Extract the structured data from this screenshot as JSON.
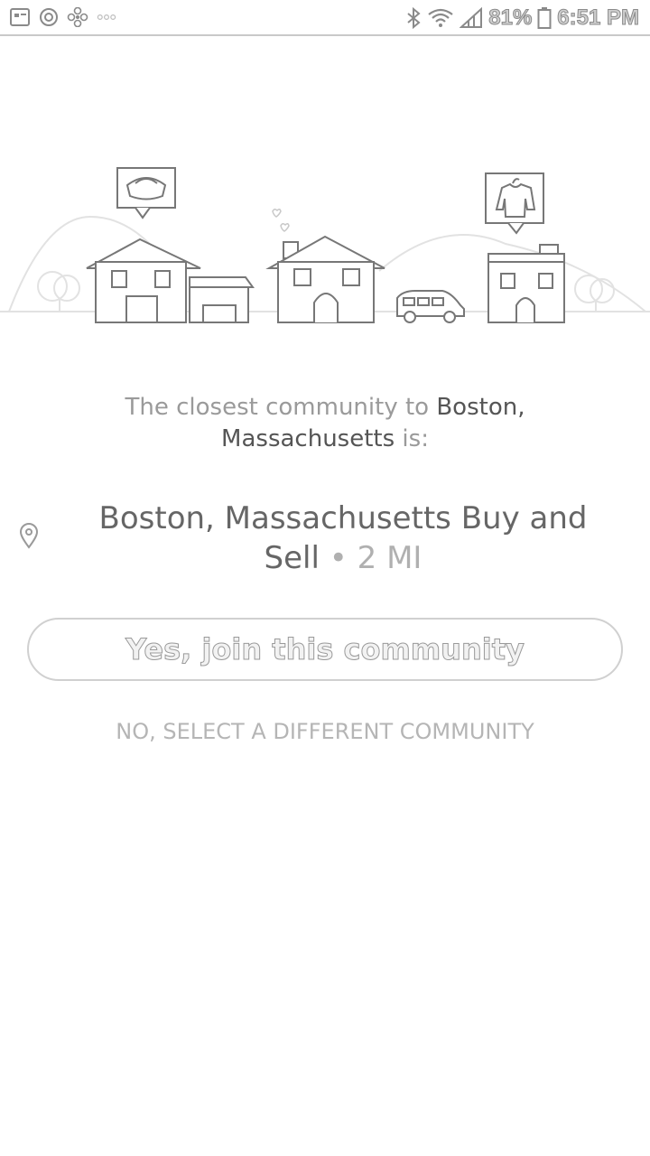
{
  "status_bar": {
    "battery_percent": "81%",
    "time": "6:51 PM",
    "left_icons": [
      "image-notification-icon",
      "target-notification-icon",
      "fan-notification-icon",
      "more-notifications-icon"
    ],
    "right_icons": [
      "bluetooth-icon",
      "wifi-icon",
      "signal-icon",
      "battery-icon"
    ]
  },
  "prompt": {
    "prefix": "The closest community to ",
    "city": "Boston,",
    "state": "Massachusetts",
    "suffix": " is:"
  },
  "community": {
    "name": "Boston, Massachusetts Buy and Sell",
    "separator": " • ",
    "distance": "2 MI"
  },
  "join_button_label": "Yes, join this community",
  "select_different_label": "NO, SELECT A DIFFERENT COMMUNITY"
}
